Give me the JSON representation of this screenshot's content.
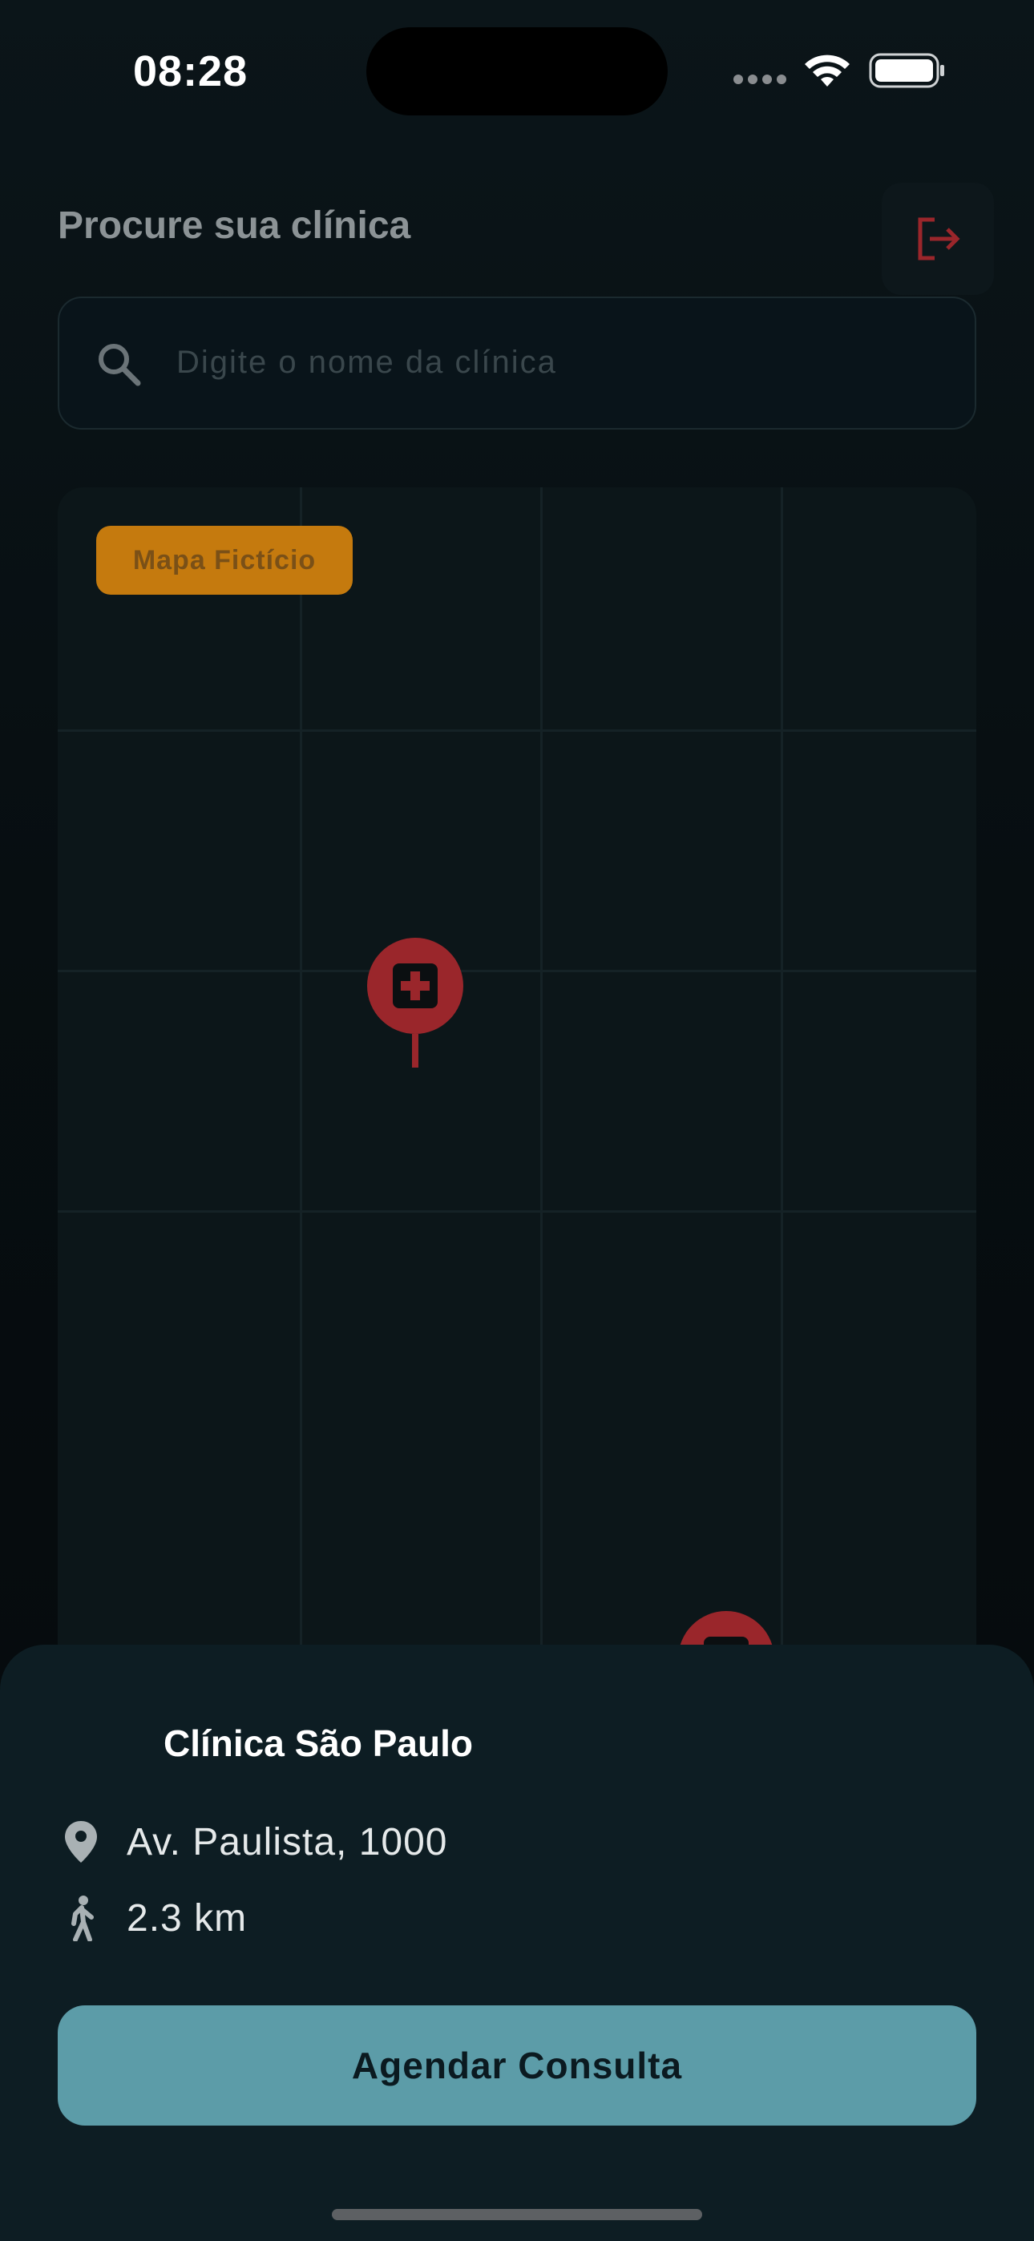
{
  "status_bar": {
    "time": "08:28"
  },
  "header": {
    "title": "Procure sua clínica",
    "logout_icon": "logout-icon"
  },
  "search": {
    "placeholder": "Digite o nome da clínica",
    "icon": "search-icon"
  },
  "map": {
    "badge": "Mapa Fictício",
    "pins": [
      {
        "icon": "medical-cross-icon",
        "color": "#9a262b"
      },
      {
        "icon": "medical-cross-icon",
        "color": "#9a262b"
      }
    ]
  },
  "sheet": {
    "clinic_name": "Clínica São Paulo",
    "address_icon": "location-pin-icon",
    "address": "Av. Paulista, 1000",
    "distance_icon": "walking-icon",
    "distance": "2.3 km",
    "cta_label": "Agendar Consulta"
  },
  "colors": {
    "accent": "#5c9ca8",
    "badge": "#c57a0e",
    "pin": "#9a262b",
    "background": "#070e11"
  }
}
